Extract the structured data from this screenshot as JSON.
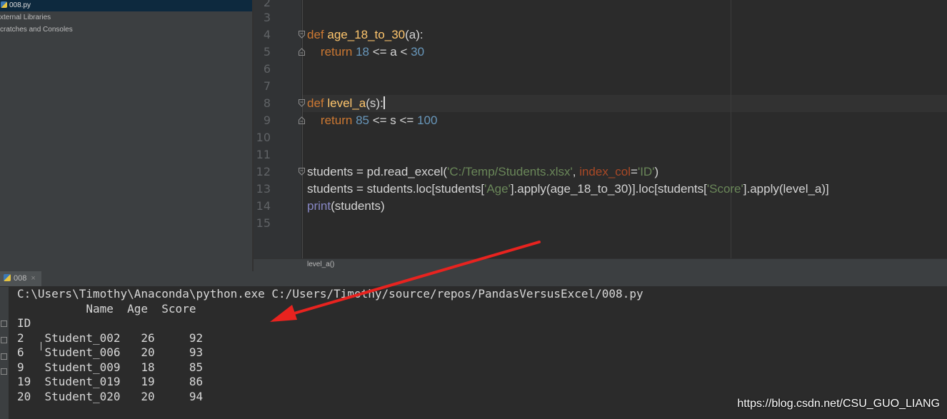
{
  "project_tree": {
    "items": [
      {
        "label": "008.py",
        "selected": true
      },
      {
        "label": "xternal Libraries",
        "selected": false
      },
      {
        "label": "cratches and Consoles",
        "selected": false
      }
    ]
  },
  "editor": {
    "line_numbers": [
      "2",
      "3",
      "4",
      "5",
      "6",
      "7",
      "8",
      "9",
      "10",
      "11",
      "12",
      "13",
      "14",
      "15"
    ],
    "code": {
      "l4": {
        "kw": "def",
        "fn": "age_18_to_30",
        "rest": "(a):"
      },
      "l5": {
        "kw": "return",
        "n1": "18",
        "op1": " <= a < ",
        "n2": "30"
      },
      "l8": {
        "kw": "def",
        "fn": "level_a",
        "rest": "(s):"
      },
      "l9": {
        "kw": "return",
        "n1": "85",
        "op1": " <= s <= ",
        "n2": "100"
      },
      "l12": {
        "p1": "students = pd.read_excel(",
        "s1": "'C:/Temp/Students.xlsx'",
        "p2": ", ",
        "kwarg": "index_col",
        "p3": "=",
        "s2": "'ID'",
        "p4": ")"
      },
      "l13": {
        "p1": "students = students.loc[students[",
        "s1": "'Age'",
        "p2": "].apply(age_18_to_30)].loc[students[",
        "s2": "'Score'",
        "p3": "].apply(level_a)]"
      },
      "l14": {
        "bi": "print",
        "rest": "(students)"
      }
    },
    "breadcrumb": "level_a()"
  },
  "run_panel": {
    "tab_label": "008",
    "tab_close": "×",
    "output": [
      "C:\\Users\\Timothy\\Anaconda\\python.exe C:/Users/Timothy/source/repos/PandasVersusExcel/008.py",
      "          Name  Age  Score",
      "ID",
      "2   Student_002   26     92",
      "6   Student_006   20     93",
      "9   Student_009   18     85",
      "19  Student_019   19     86",
      "20  Student_020   20     94"
    ]
  },
  "annotation": {
    "color": "#e8231f"
  },
  "watermark": "https://blog.csdn.net/CSU_GUO_LIANG"
}
